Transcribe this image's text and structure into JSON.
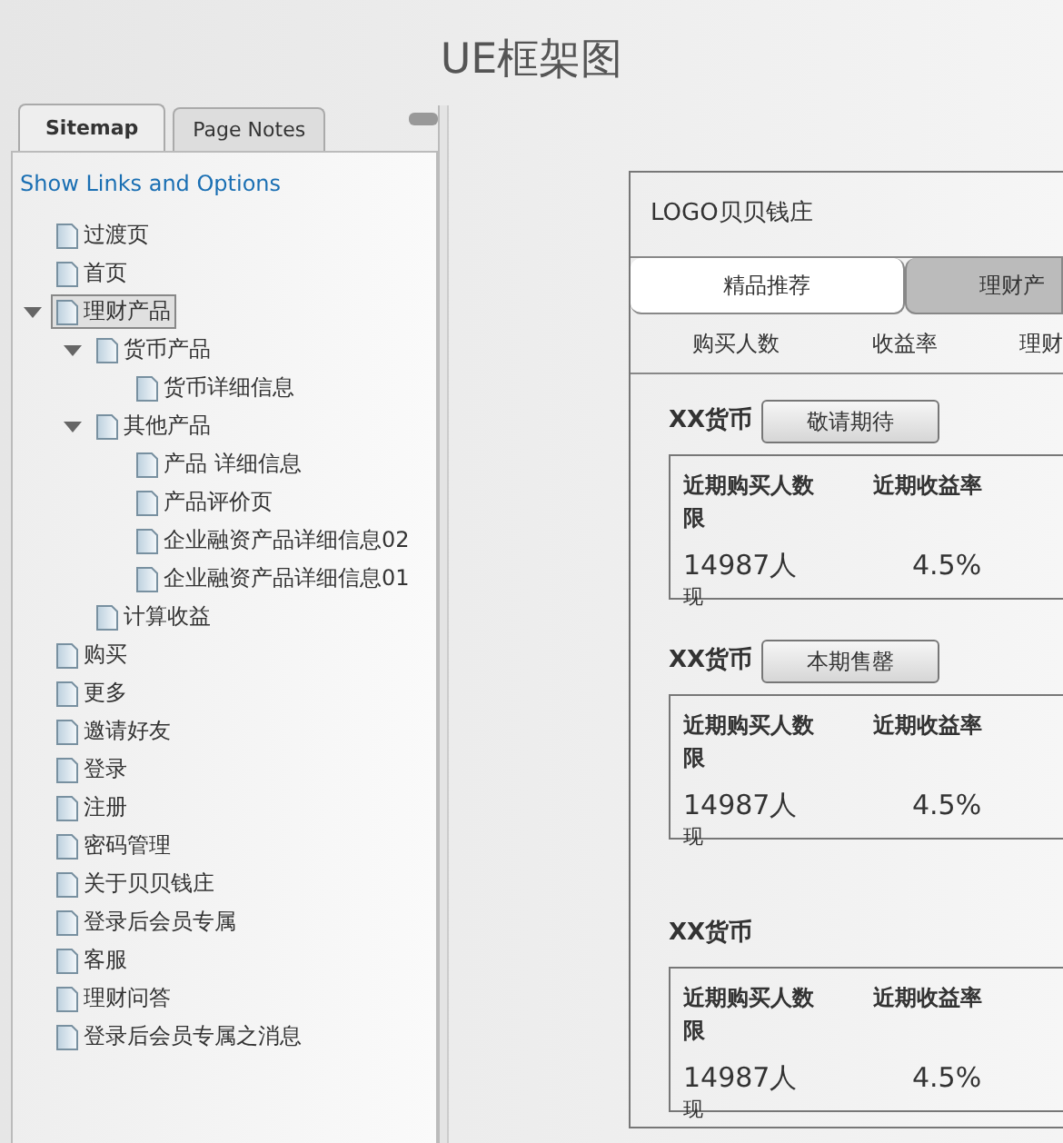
{
  "title": "UE框架图",
  "panel": {
    "tabs": [
      {
        "label": "Sitemap",
        "selected": true
      },
      {
        "label": "Page Notes",
        "selected": false
      }
    ],
    "link": "Show Links and Options",
    "tree": [
      {
        "label": "过渡页",
        "selected": false
      },
      {
        "label": "首页",
        "selected": false
      },
      {
        "label": "理财产品",
        "selected": true,
        "expanded": true,
        "children": [
          {
            "label": "货币产品",
            "selected": false,
            "expanded": true,
            "children": [
              {
                "label": "货币详细信息",
                "selected": false
              }
            ]
          },
          {
            "label": "其他产品",
            "selected": false,
            "expanded": true,
            "children": [
              {
                "label": "产品 详细信息",
                "selected": false
              },
              {
                "label": "产品评价页",
                "selected": false
              },
              {
                "label": "企业融资产品详细信息02",
                "selected": false
              },
              {
                "label": "企业融资产品详细信息01",
                "selected": false
              }
            ]
          },
          {
            "label": "计算收益",
            "selected": false
          }
        ]
      },
      {
        "label": "购买",
        "selected": false
      },
      {
        "label": "更多",
        "selected": false
      },
      {
        "label": "邀请好友",
        "selected": false
      },
      {
        "label": "登录",
        "selected": false
      },
      {
        "label": "注册",
        "selected": false
      },
      {
        "label": "密码管理",
        "selected": false
      },
      {
        "label": "关于贝贝钱庄",
        "selected": false
      },
      {
        "label": "登录后会员专属",
        "selected": false
      },
      {
        "label": "客服",
        "selected": false
      },
      {
        "label": "理财问答",
        "selected": false
      },
      {
        "label": "登录后会员专属之消息",
        "selected": false
      }
    ]
  },
  "wireframe": {
    "logo": "LOGO贝贝钱庄",
    "tabs": [
      {
        "label": "精品推荐",
        "selected": false
      },
      {
        "label": "理财产",
        "selected": true
      }
    ],
    "sort_items": [
      "购买人数",
      "收益率",
      "理财"
    ],
    "products": [
      {
        "name": "XX货币",
        "button": "敬请期待",
        "headers": [
          "近期购买人数",
          "近期收益率"
        ],
        "header_overflow": "限",
        "values": [
          "14987人",
          "4.5%"
        ],
        "note": "现"
      },
      {
        "name": "XX货币",
        "button": "本期售罄",
        "headers": [
          "近期购买人数",
          "近期收益率"
        ],
        "header_overflow": "限",
        "values": [
          "14987人",
          "4.5%"
        ],
        "note": "现"
      },
      {
        "name": "XX货币",
        "headers": [
          "近期购买人数",
          "近期收益率"
        ],
        "header_overflow": "限",
        "values": [
          "14987人",
          "4.5%"
        ],
        "note": "现"
      }
    ]
  }
}
